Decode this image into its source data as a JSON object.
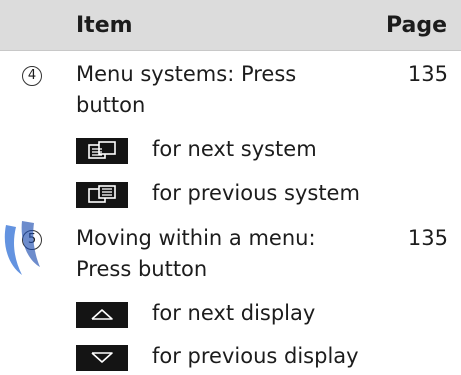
{
  "header": {
    "item": "Item",
    "page": "Page"
  },
  "rows": [
    {
      "number": "4",
      "line1": "Menu systems: Press",
      "line2": "button",
      "page": "135",
      "subs": [
        {
          "icon": "next-system-icon",
          "label": "for next system"
        },
        {
          "icon": "previous-system-icon",
          "label": "for previous system"
        }
      ]
    },
    {
      "number": "5",
      "line1": "Moving within a menu:",
      "line2": "Press button",
      "page": "135",
      "subs": [
        {
          "icon": "up-arrow-icon",
          "label": "for next display"
        },
        {
          "icon": "down-arrow-icon",
          "label": "for previous display"
        }
      ]
    }
  ]
}
